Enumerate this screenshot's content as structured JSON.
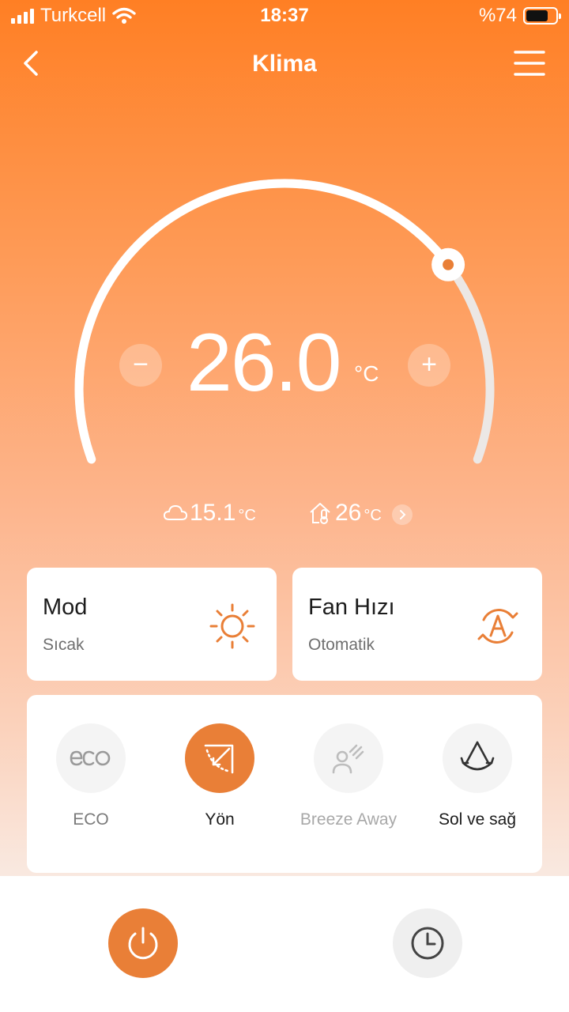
{
  "status_bar": {
    "carrier": "Turkcell",
    "time": "18:37",
    "battery_text": "%74",
    "battery_level": 0.74
  },
  "nav": {
    "title": "Klima",
    "back_icon": "chevron-left-icon",
    "menu_icon": "hamburger-menu-icon"
  },
  "thermostat": {
    "temperature": "26.0",
    "unit": "°C",
    "minus_label": "−",
    "plus_label": "+",
    "setpoint_fraction": 0.74
  },
  "readings": {
    "outdoor_value": "15.1",
    "outdoor_unit": "°C",
    "outdoor_icon": "cloud-icon",
    "indoor_value": "26",
    "indoor_unit": "°C",
    "indoor_icon": "home-thermometer-icon"
  },
  "mode_card": {
    "title": "Mod",
    "value": "Sıcak",
    "icon": "sun-icon"
  },
  "fan_card": {
    "title": "Fan Hızı",
    "value": "Otomatik",
    "icon": "auto-fan-icon"
  },
  "options": [
    {
      "label": "ECO",
      "icon": "eco-icon",
      "active": false
    },
    {
      "label": "Yön",
      "icon": "direction-icon",
      "active": true
    },
    {
      "label": "Breeze Away",
      "icon": "breeze-away-icon",
      "active": false
    },
    {
      "label": "Sol ve sağ",
      "icon": "swing-left-right-icon",
      "active": false
    }
  ],
  "bottom": {
    "power_icon": "power-icon",
    "timer_icon": "clock-icon"
  },
  "colors": {
    "accent": "#e97f37",
    "header_orange": "#ff7f24",
    "card_bg": "#ffffff"
  }
}
